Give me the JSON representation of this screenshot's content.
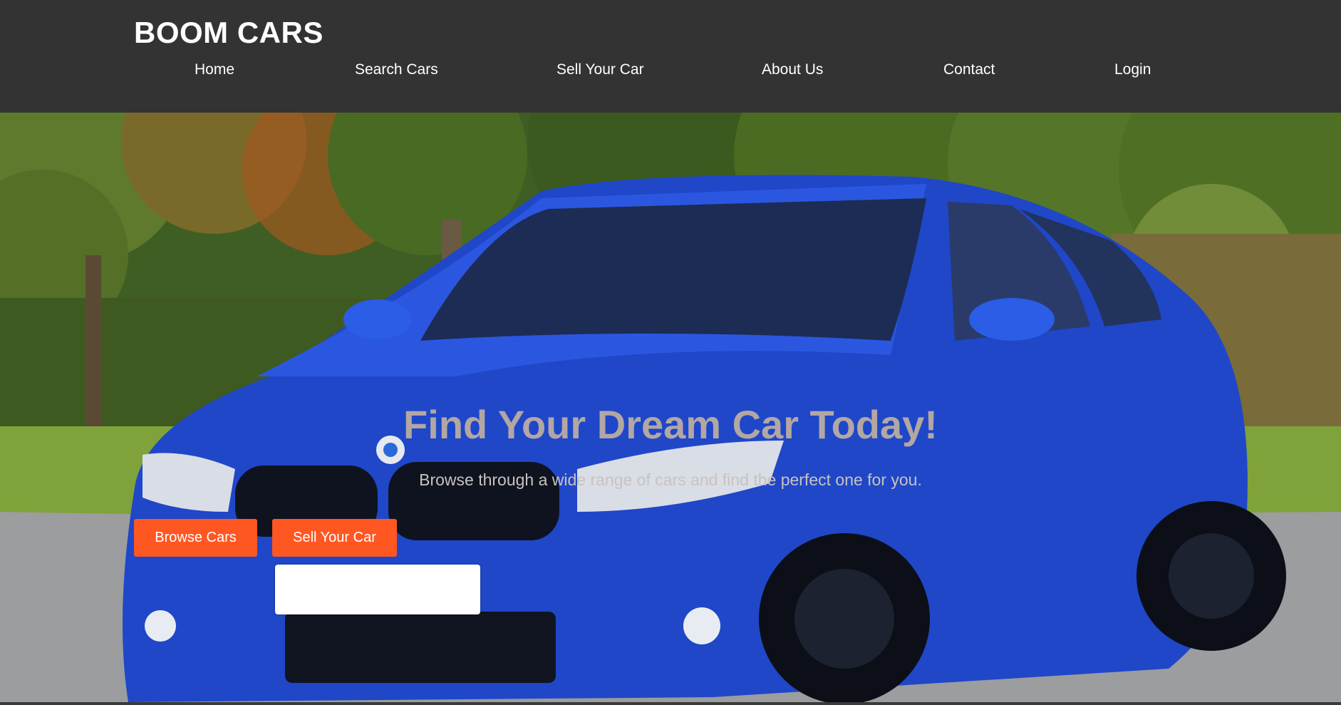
{
  "header": {
    "brand": "BOOM CARS",
    "nav": [
      {
        "label": "Home"
      },
      {
        "label": "Search Cars"
      },
      {
        "label": "Sell Your Car"
      },
      {
        "label": "About Us"
      },
      {
        "label": "Contact"
      },
      {
        "label": "Login"
      }
    ]
  },
  "hero": {
    "title": "Find Your Dream Car Today!",
    "subtitle": "Browse through a wide range of cars and find the perfect one for you.",
    "buttons": {
      "browse_label": "Browse Cars",
      "sell_label": "Sell Your Car"
    },
    "background_image": "blue-sports-car-in-park-photo"
  },
  "colors": {
    "header_bg": "#333333",
    "accent": "#ff5722",
    "nav_text": "#ffffff",
    "hero_title": "#b3a7a4"
  }
}
